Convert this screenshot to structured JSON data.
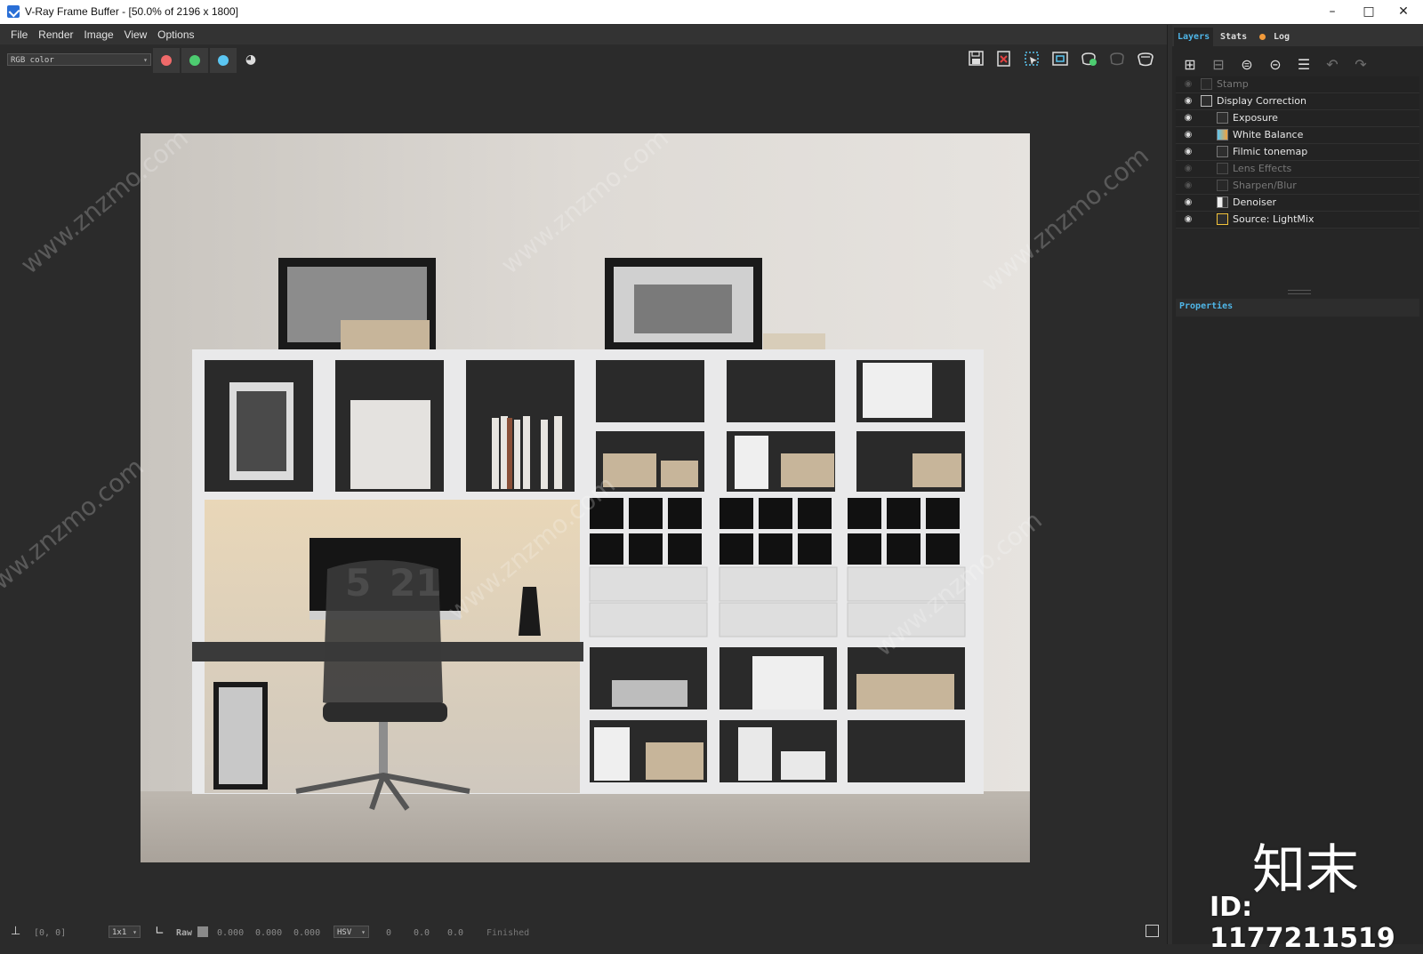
{
  "window": {
    "title": "V-Ray Frame Buffer - [50.0% of 2196 x 1800]",
    "minimize": "–",
    "maximize": "□",
    "close": "✕"
  },
  "menu": [
    "File",
    "Render",
    "Image",
    "View",
    "Options"
  ],
  "toolbar": {
    "channel_select": "RGB color",
    "channel_colors": {
      "red": "#f06a6a",
      "green": "#4dcc70",
      "blue": "#5bc6f2"
    },
    "right_icons": [
      "save-icon",
      "clear-icon",
      "region-render-icon",
      "track-mouse-icon",
      "render-last-icon",
      "stop-render-icon",
      "render-icon"
    ]
  },
  "status": {
    "coords": "[0, 0]",
    "zoom": "1x1",
    "mode_label": "Raw",
    "rgb_values": [
      "0.000",
      "0.000",
      "0.000"
    ],
    "color_model": "HSV",
    "hsv_values": [
      "0",
      "0.0",
      "0.0"
    ],
    "state": "Finished"
  },
  "panel": {
    "tabs": [
      "Layers",
      "Stats",
      "Log"
    ],
    "layers": [
      {
        "name": "Stamp",
        "visible": false,
        "indent": 0
      },
      {
        "name": "Display Correction",
        "visible": true,
        "indent": 0
      },
      {
        "name": "Exposure",
        "visible": true,
        "indent": 1
      },
      {
        "name": "White Balance",
        "visible": true,
        "indent": 1
      },
      {
        "name": "Filmic tonemap",
        "visible": true,
        "indent": 1
      },
      {
        "name": "Lens Effects",
        "visible": false,
        "indent": 1
      },
      {
        "name": "Sharpen/Blur",
        "visible": false,
        "indent": 1
      },
      {
        "name": "Denoiser",
        "visible": true,
        "indent": 1
      },
      {
        "name": "Source: LightMix",
        "visible": true,
        "indent": 1
      }
    ],
    "properties_label": "Properties"
  },
  "render": {
    "clock_digits": [
      "5",
      "21"
    ]
  },
  "watermark": {
    "site": "www.znzmo.com",
    "brand": "知末",
    "id": "ID: 1177211519"
  },
  "colors": {
    "accent": "#4fb6e8",
    "log_dot": "#f29a3a",
    "bg": "#2b2b2b"
  }
}
